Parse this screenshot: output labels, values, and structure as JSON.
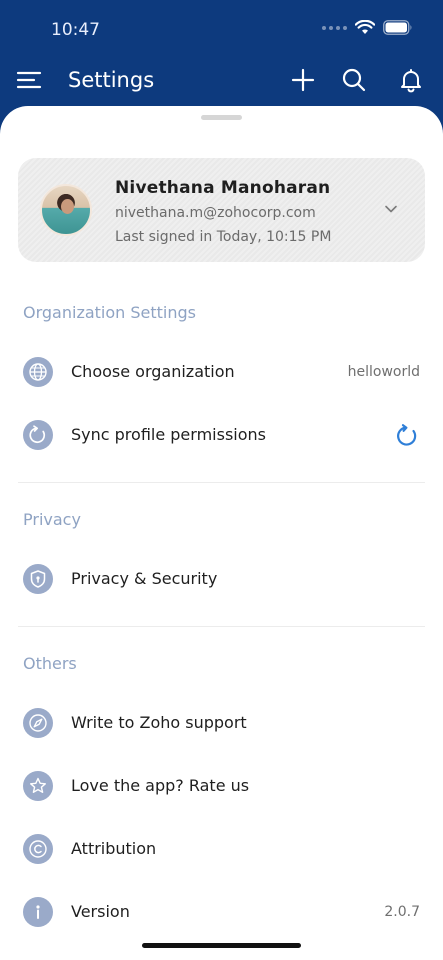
{
  "status_bar": {
    "time": "10:47"
  },
  "header": {
    "title": "Settings"
  },
  "profile": {
    "name": "Nivethana Manoharan",
    "email": "nivethana.m@zohocorp.com",
    "last_signed_in": "Last signed in Today, 10:15 PM"
  },
  "sections": {
    "organization": {
      "title": "Organization Settings",
      "choose_org_label": "Choose organization",
      "choose_org_value": "helloworld",
      "sync_label": "Sync profile permissions"
    },
    "privacy": {
      "title": "Privacy",
      "privacy_label": "Privacy & Security"
    },
    "others": {
      "title": "Others",
      "support_label": "Write to Zoho support",
      "rate_label": "Love the app? Rate us",
      "attribution_label": "Attribution",
      "version_label": "Version",
      "version_value": "2.0.7"
    }
  },
  "icons": {
    "menu": "menu-icon",
    "add": "plus-icon",
    "search": "search-icon",
    "notifications": "bell-icon",
    "org": "globe-icon",
    "sync": "refresh-icon",
    "privacy": "shield-icon",
    "support": "compass-icon",
    "rate": "star-icon",
    "attribution": "copyright-icon",
    "version": "info-icon"
  },
  "colors": {
    "header_bg": "#0d3a7e",
    "section_title": "#8fa3c3",
    "icon_bg": "#9aaac9",
    "accent": "#2f7fd8"
  }
}
